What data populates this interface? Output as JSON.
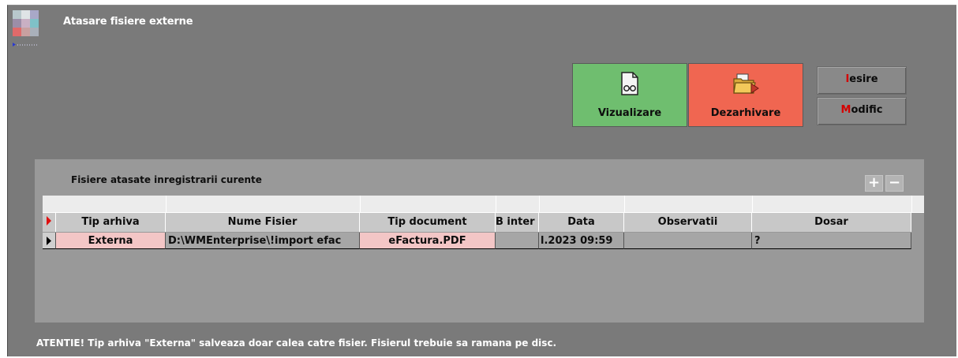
{
  "window": {
    "title": "Atasare fisiere externe"
  },
  "actions": {
    "view": {
      "label": "Vizualizare",
      "icon": "document-glasses-icon",
      "color": "#6fbe6f"
    },
    "extract": {
      "label": "Dezarhivare",
      "icon": "folder-export-icon",
      "color": "#f06651"
    },
    "exit": {
      "hotkey": "I",
      "rest": "esire"
    },
    "modify": {
      "hotkey": "M",
      "rest": "odific"
    }
  },
  "panel": {
    "title": "Fisiere atasate inregistrarii curente",
    "add_icon": "plus-icon",
    "remove_icon": "minus-icon"
  },
  "grid": {
    "columns": [
      "Tip arhiva",
      "Nume Fisier",
      "Tip document",
      "B inter",
      "Data",
      "Observatii",
      "Dosar"
    ],
    "rows": [
      {
        "tip_arhiva": "Externa",
        "nume_fisier": "D:\\WMEnterprise\\!import efac",
        "tip_document": "eFactura.PDF",
        "b_inter": "",
        "data": "l.2023 09:59",
        "observatii": "",
        "dosar": "?"
      }
    ]
  },
  "note": "ATENTIE!   Tip arhiva \"Externa\" salveaza doar calea catre fisier. Fisierul trebuie sa ramana pe disc."
}
